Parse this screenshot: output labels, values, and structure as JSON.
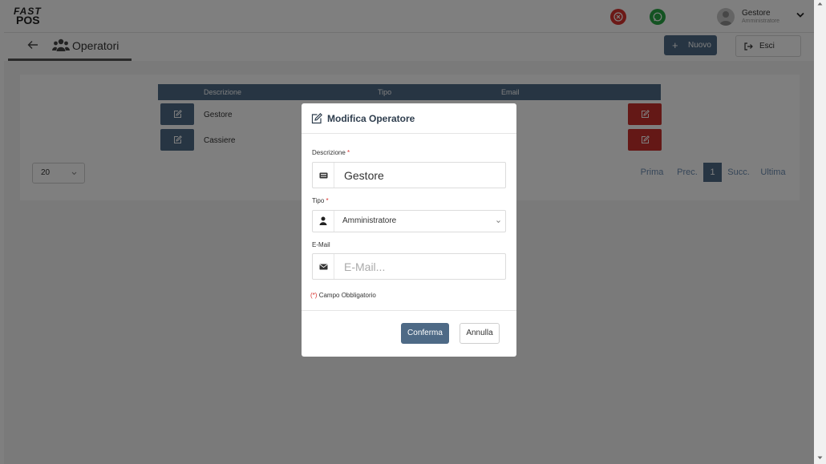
{
  "header": {
    "logo_line1": "FAST",
    "logo_line2": "POS",
    "user_name": "Gestore",
    "user_role": "Amministratore"
  },
  "subheader": {
    "page_title": "Operatori",
    "new_button": "Nuovo",
    "exit_button": "Esci"
  },
  "table": {
    "columns": [
      "",
      "Descrizione",
      "Tipo",
      "Email"
    ],
    "rows": [
      {
        "descrizione": "Gestore"
      },
      {
        "descrizione": "Cassiere"
      }
    ]
  },
  "pagination": {
    "per_page": "20",
    "first": "Prima",
    "prev": "Prec.",
    "current": "1",
    "next": "Succ.",
    "last": "Ultima"
  },
  "modal": {
    "title": "Modifica Operatore",
    "descrizione_label": "Descrizione",
    "descrizione_value": "Gestore",
    "tipo_label": "Tipo",
    "tipo_value": "Amministratore",
    "email_label": "E-Mail",
    "email_placeholder": "E-Mail...",
    "required_marker": "*",
    "required_note_marker": "(*)",
    "required_note": "Campo Obbligatorio",
    "confirm_button": "Conferma",
    "cancel_button": "Annulla"
  },
  "colors": {
    "primary": "#4e6a86",
    "danger": "#c8302c",
    "success": "#28a745"
  }
}
